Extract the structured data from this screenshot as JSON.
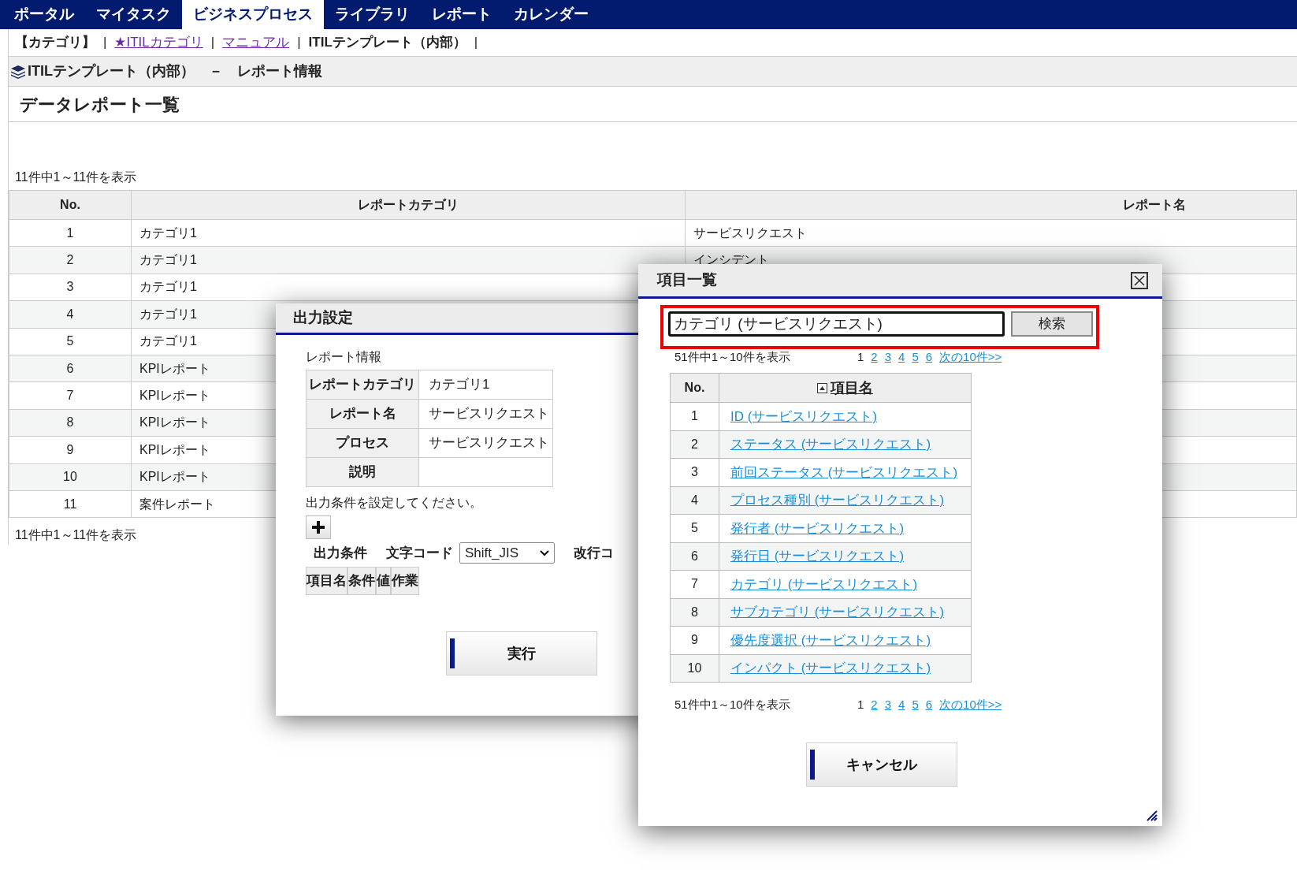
{
  "nav": {
    "tabs": [
      {
        "label": "ポータル",
        "selected": false
      },
      {
        "label": "マイタスク",
        "selected": false
      },
      {
        "label": "ビジネスプロセス",
        "selected": true
      },
      {
        "label": "ライブラリ",
        "selected": false
      },
      {
        "label": "レポート",
        "selected": false
      },
      {
        "label": "カレンダー",
        "selected": false
      }
    ]
  },
  "breadcrumb": [
    {
      "label": "【カテゴリ】",
      "kind": "text",
      "separator": "|"
    },
    {
      "label": "★ITILカテゴリ",
      "kind": "visited_link",
      "separator": "|"
    },
    {
      "label": "マニュアル",
      "kind": "visited_link",
      "separator": "|"
    },
    {
      "label": "ITILテンプレート（内部）",
      "kind": "text",
      "separator": "|"
    }
  ],
  "section_header": "ITILテンプレート（内部）　－　レポート情報",
  "page_title": "データレポート一覧",
  "count_top": "11件中1～11件を表示",
  "table": {
    "columns": [
      "No.",
      "レポートカテゴリ",
      "レポート名"
    ],
    "rows": [
      [
        "1",
        "カテゴリ1",
        "サービスリクエスト"
      ],
      [
        "2",
        "カテゴリ1",
        "インシデント"
      ],
      [
        "3",
        "カテゴリ1"
      ],
      [
        "4",
        "カテゴリ1"
      ],
      [
        "5",
        "カテゴリ1"
      ],
      [
        "6",
        "KPIレポート"
      ],
      [
        "7",
        "KPIレポート"
      ],
      [
        "8",
        "KPIレポート"
      ],
      [
        "9",
        "KPIレポート"
      ],
      [
        "10",
        "KPIレポート"
      ],
      [
        "11",
        "案件レポート"
      ]
    ]
  },
  "count_bottom": "11件中1～11件を表示",
  "output_dialog": {
    "title": "出力設定",
    "section_label": "レポート情報",
    "info": [
      {
        "label": "レポートカテゴリ",
        "value": "カテゴリ1"
      },
      {
        "label": "レポート名",
        "value": "サービスリクエスト"
      },
      {
        "label": "プロセス",
        "value": "サービスリクエスト"
      },
      {
        "label": "説明"
      }
    ],
    "instruction": "出力条件を設定してください。",
    "conditions_label": "出力条件",
    "encoding_label": "文字コード",
    "encoding_value": "Shift_JIS",
    "newline_label": "改行コ",
    "condition_columns": [
      "項目名",
      "条件",
      "値",
      "作業"
    ],
    "run_button": "実行"
  },
  "items_dialog": {
    "title": "項目一覧",
    "search_value": "カテゴリ (サービスリクエスト)",
    "search_button": "検索",
    "pagination_top": {
      "summary": "51件中1～10件を表示",
      "pages": [
        {
          "label": "1",
          "selected": true
        },
        {
          "label": "2",
          "selected": false
        },
        {
          "label": "3",
          "selected": false
        },
        {
          "label": "4",
          "selected": false
        },
        {
          "label": "5",
          "selected": false
        },
        {
          "label": "6",
          "selected": false
        }
      ],
      "next": "次の10件>>"
    },
    "columns": [
      "No.",
      "項目名"
    ],
    "rows": [
      [
        "1",
        "ID (サービスリクエスト)"
      ],
      [
        "2",
        "ステータス (サービスリクエスト)"
      ],
      [
        "3",
        "前回ステータス (サービスリクエスト)"
      ],
      [
        "4",
        "プロセス種別 (サービスリクエスト)"
      ],
      [
        "5",
        "発行者 (サービスリクエスト)"
      ],
      [
        "6",
        "発行日 (サービスリクエスト)"
      ],
      [
        "7",
        "カテゴリ (サービスリクエスト)"
      ],
      [
        "8",
        "サブカテゴリ (サービスリクエスト)"
      ],
      [
        "9",
        "優先度選択 (サービスリクエスト)"
      ],
      [
        "10",
        "インパクト (サービスリクエスト)"
      ]
    ],
    "pagination_bottom": {
      "summary": "51件中1～10件を表示",
      "pages": [
        {
          "label": "1",
          "selected": true
        },
        {
          "label": "2",
          "selected": false
        },
        {
          "label": "3",
          "selected": false
        },
        {
          "label": "4",
          "selected": false
        },
        {
          "label": "5",
          "selected": false
        },
        {
          "label": "6",
          "selected": false
        }
      ],
      "next": "次の10件>>"
    },
    "cancel_button": "キャンセル"
  }
}
